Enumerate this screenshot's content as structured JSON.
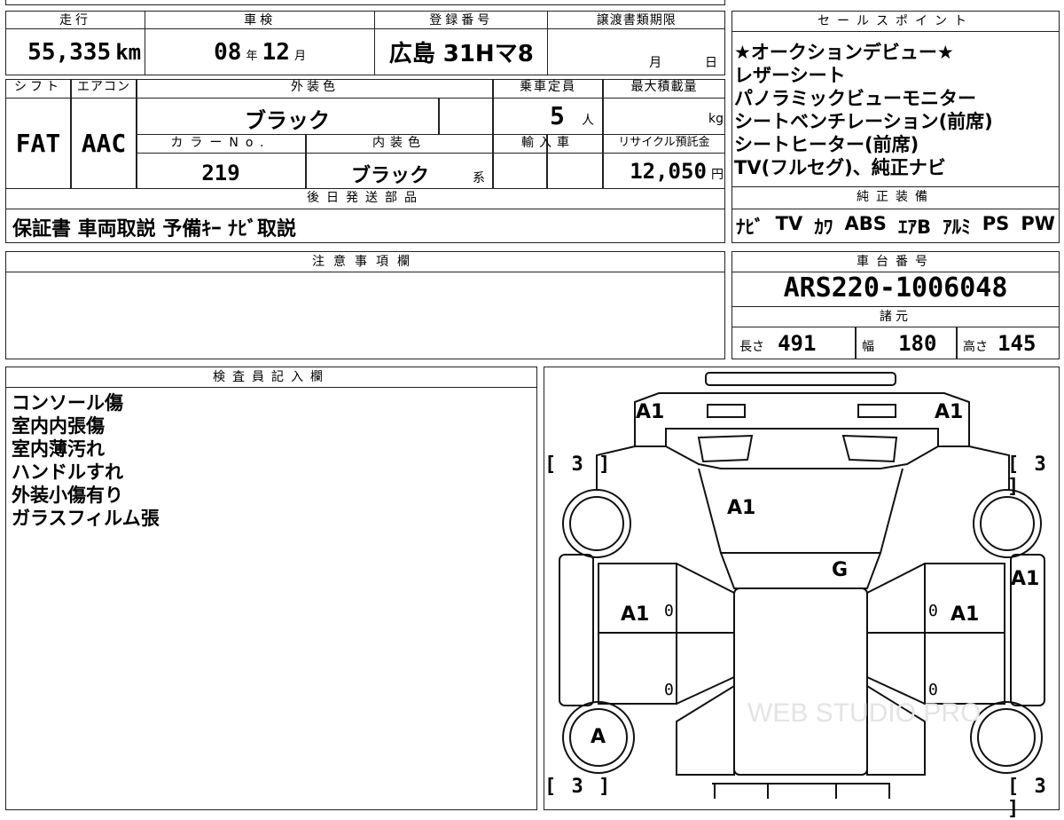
{
  "top": {
    "mileage_header": "走行",
    "mileage_value": "55,335",
    "mileage_unit": "km",
    "inspection_header": "車検",
    "inspection_year": "08",
    "inspection_year_unit": "年",
    "inspection_month": "12",
    "inspection_month_unit": "月",
    "reg_header": "登録番号",
    "reg_value": "広島 31Hマ8",
    "transfer_header": "譲渡書類期限",
    "transfer_month": "月",
    "transfer_day": "日",
    "shift_header": "シフト",
    "aircon_header": "エアコン",
    "shift_value": "FAT",
    "aircon_value": "AAC",
    "exterior_header": "外装色",
    "exterior_value": "ブラック",
    "capacity_header": "乗車定員",
    "capacity_value": "5",
    "capacity_unit": "人",
    "maxload_header": "最大積載量",
    "maxload_unit": "kg",
    "colorno_header": "カラーNo.",
    "colorno_value": "219",
    "interior_header": "内装色",
    "interior_value": "ブラック",
    "interior_suffix": "系",
    "import_header": "輸入車",
    "recycle_header": "リサイクル預託金",
    "recycle_value": "12,050",
    "recycle_unit": "円",
    "later_header": "後日発送部品",
    "later_value": "保証書 車両取説 予備ｷｰ ﾅﾋﾞ取説"
  },
  "sales": {
    "header": "セールスポイント",
    "lines": [
      "★オークションデビュー★",
      "レザーシート",
      "パノラミックビューモニター",
      "シートベンチレーション(前席)",
      "シートヒーター(前席)",
      "TV(フルセグ)、純正ナビ"
    ]
  },
  "equipment": {
    "header": "純正装備",
    "items": [
      "ﾅﾋﾞ",
      "TV",
      "ｶﾜ",
      "ABS",
      "ｴｱB",
      "ｱﾙﾐ",
      "PS",
      "PW"
    ]
  },
  "notes": {
    "header": "注意事項欄"
  },
  "chassis": {
    "header": "車台番号",
    "value": "ARS220-1006048",
    "spec_header": "諸元",
    "length_label": "長さ",
    "length_value": "491",
    "width_label": "幅",
    "width_value": "180",
    "height_label": "高さ",
    "height_value": "145"
  },
  "inspector": {
    "header": "検査員記入欄",
    "lines": [
      "コンソール傷",
      "室内内張傷",
      "室内薄汚れ",
      "ハンドルすれ",
      "外装小傷有り",
      "ガラスフィルム張"
    ]
  },
  "diagram": {
    "marks": {
      "front_left": "A1",
      "front_right": "A1",
      "hood": "A1",
      "windshield": "G",
      "right_fender": "A1",
      "left_door": "A1",
      "right_door": "A1",
      "left_rear_wheel": "A"
    },
    "tires": [
      "[ 3 ]",
      "[ 3 ]",
      "[ 3 ]",
      "[ 3 ]"
    ],
    "zeros": [
      "0",
      "0",
      "0",
      "0"
    ],
    "watermark": "WEB STUDIO PRO"
  }
}
